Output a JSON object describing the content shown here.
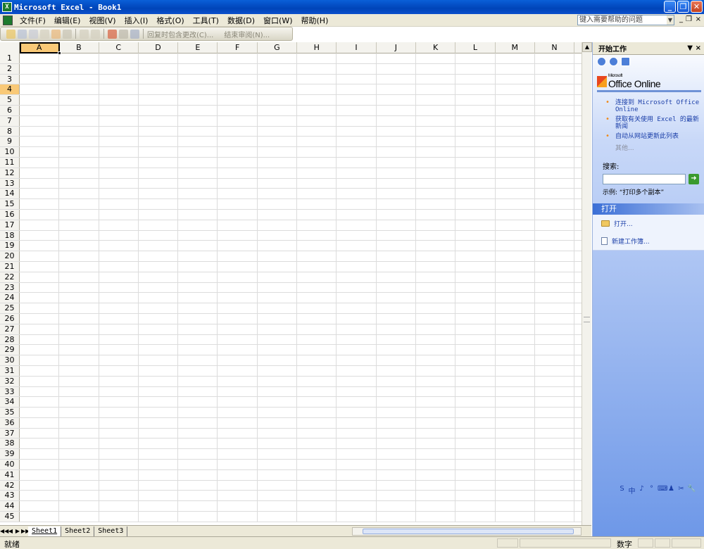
{
  "window": {
    "title": "Microsoft Excel - Book1",
    "app_icon": "X",
    "minimize": "_",
    "restore": "❐",
    "close": "✕"
  },
  "menubar": {
    "items": [
      "文件(F)",
      "编辑(E)",
      "视图(V)",
      "插入(I)",
      "格式(O)",
      "工具(T)",
      "数据(D)",
      "窗口(W)",
      "帮助(H)"
    ],
    "help_placeholder": "键入需要帮助的问题",
    "doc_min": "_",
    "doc_restore": "❐",
    "doc_close": "×"
  },
  "toolbar": {
    "reply_label": "回复时包含更改(C)...",
    "end_review_label": "结束审阅(N)..."
  },
  "grid": {
    "columns": [
      "A",
      "B",
      "C",
      "D",
      "E",
      "F",
      "G",
      "H",
      "I",
      "J",
      "K",
      "L",
      "M",
      "N"
    ],
    "rows": [
      "1",
      "2",
      "3",
      "4",
      "5",
      "6",
      "7",
      "8",
      "9",
      "10",
      "11",
      "12",
      "13",
      "14",
      "15",
      "16",
      "17",
      "18",
      "19",
      "20",
      "21",
      "22",
      "23",
      "24",
      "25",
      "26",
      "27",
      "28",
      "29",
      "30",
      "31",
      "32",
      "33",
      "34",
      "35",
      "36",
      "37",
      "38",
      "39",
      "40",
      "41",
      "42",
      "43",
      "44",
      "45"
    ],
    "selected_column": "A",
    "selected_row": "4"
  },
  "sheets": {
    "tabs": [
      "Sheet1",
      "Sheet2",
      "Sheet3"
    ],
    "active": "Sheet1",
    "nav": [
      "◀◀",
      "◀",
      "▶",
      "▶▶"
    ]
  },
  "status": {
    "left": "就绪",
    "mode": "数字"
  },
  "taskpane": {
    "title": "开始工作",
    "dropdown": "▼",
    "close": "×",
    "office_small": "Microsoft",
    "office_brand": "Office Online",
    "links": [
      "连接到 Microsoft Office Online",
      "获取有关使用 Excel 的最新新闻",
      "自动从网站更新此列表"
    ],
    "more": "其他...",
    "search_label": "搜索:",
    "search_value": "",
    "go": "➜",
    "example": "示例:  “打印多个副本”",
    "open_section": "打开",
    "open_items": [
      "打开...",
      "新建工作簿..."
    ],
    "ime": [
      "S",
      "中",
      "♪",
      "°",
      "⌨",
      "♟",
      "✂",
      "🔧"
    ]
  }
}
